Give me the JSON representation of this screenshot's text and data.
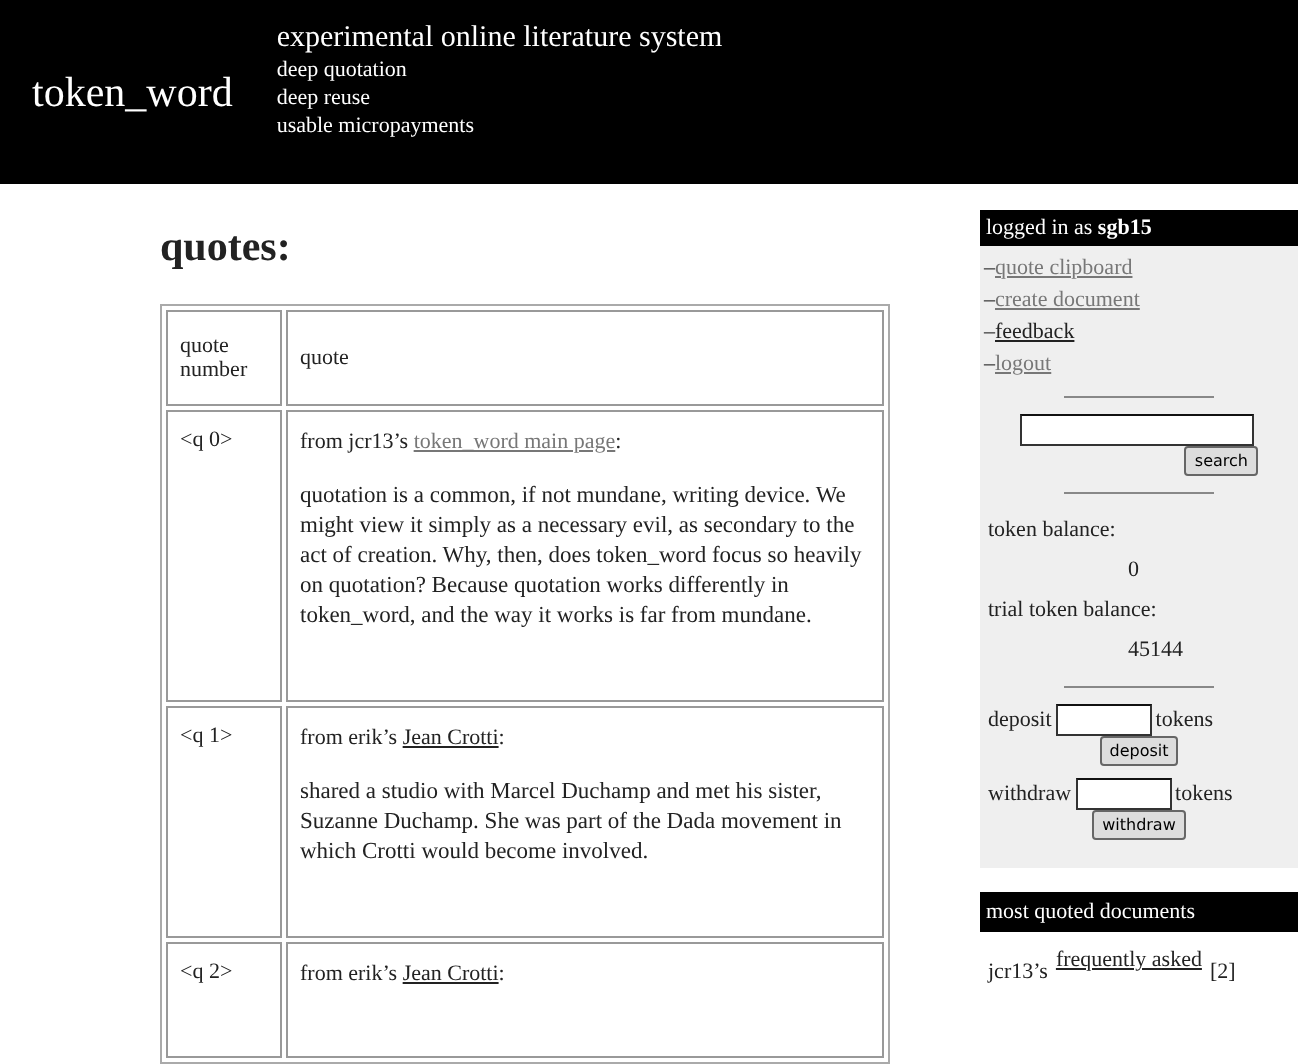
{
  "header": {
    "logo": "token_word",
    "title": "experimental online literature system",
    "taglines": [
      "deep quotation",
      "deep reuse",
      "usable micropayments"
    ]
  },
  "heading": "quotes:",
  "table": {
    "columns": [
      "quote number",
      "quote"
    ],
    "rows": [
      {
        "number": "<q 0>",
        "source": [
          {
            "kind": "plain",
            "text": "from jcr13’s"
          },
          {
            "kind": "link",
            "text": "token_word main page",
            "visited": true
          },
          {
            "kind": "plain",
            "text": ":"
          }
        ],
        "text": "quotation is a common, if not mundane, writing device. We might view it simply as a necessary evil, as secondary to the act of creation. Why, then, does token_word focus so heavily on quotation? Because quotation works differently in token_word, and the way it works is far from mundane."
      },
      {
        "number": "<q 1>",
        "source": [
          {
            "kind": "plain",
            "text": "from erik’s"
          },
          {
            "kind": "link",
            "text": "Jean Crotti",
            "visited": false
          },
          {
            "kind": "plain",
            "text": ":"
          }
        ],
        "text": "shared a studio with Marcel Duchamp and met his sister, Suzanne Duchamp. She was part of the Dada movement in which Crotti would become involved."
      },
      {
        "number": "<q 2>",
        "source": [
          {
            "kind": "plain",
            "text": "from erik’s"
          },
          {
            "kind": "link",
            "text": "Jean Crotti",
            "visited": false
          },
          {
            "kind": "plain",
            "text": ":"
          }
        ]
      }
    ]
  },
  "sidebar": {
    "login": "logged in as **sgb15**",
    "links": [
      {
        "dash": "–",
        "label": "quote clipboard",
        "visited": true
      },
      {
        "dash": "–",
        "label": "create document",
        "visited": true
      },
      {
        "dash": "–",
        "label": "feedback",
        "visited": false
      },
      {
        "dash": "–",
        "label": "logout",
        "visited": true
      }
    ],
    "search_button": "search",
    "token_balance_label": "token balance:",
    "token_balance": "0",
    "trial_balance_label": "trial token balance:",
    "trial_balance": "45144",
    "deposit": {
      "label": "deposit",
      "unit": "tokens",
      "button": "deposit"
    },
    "withdraw": {
      "label": "withdraw",
      "unit": "tokens",
      "button": "withdraw"
    },
    "most_quoted_title": "most quoted documents",
    "most_quoted": [
      {
        "owner": "jcr13’s",
        "link": "frequently asked",
        "count": "[2]"
      }
    ]
  }
}
